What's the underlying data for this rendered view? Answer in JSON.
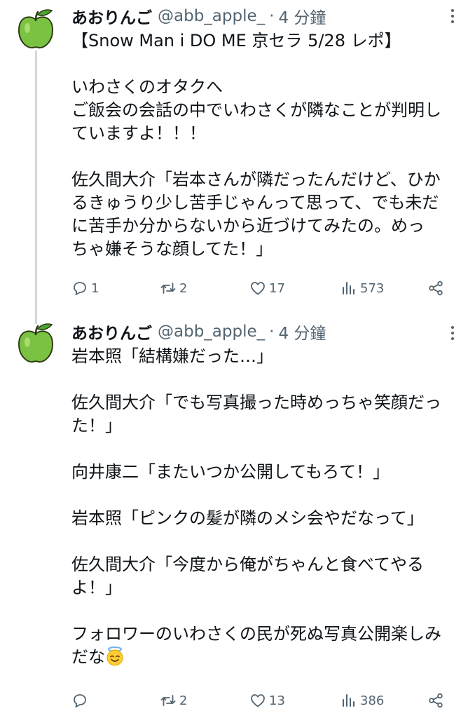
{
  "thread": [
    {
      "avatar_icon": "green-apple-icon",
      "name": "あおりんご",
      "handle": "@abb_apple_",
      "separator": "·",
      "time": "4 分鐘",
      "text": "【Snow Man i DO ME 京セラ 5/28 レポ】\n\nいわさくのオタクへ\nご飯会の会話の中でいわさくが隣なことが判明し\nていますよ！！！\n\n佐久間大介「岩本さんが隣だったんだけど、ひか\nるきゅうり少し苦手じゃんって思って、でも未だ\nに苦手か分からないから近づけてみたの。めっ\nちゃ嫌そうな顔してた！」",
      "actions": {
        "replies": "1",
        "reposts": "2",
        "likes": "17",
        "views": "573"
      }
    },
    {
      "avatar_icon": "green-apple-icon",
      "name": "あおりんご",
      "handle": "@abb_apple_",
      "separator": "·",
      "time": "4 分鐘",
      "text": "岩本照「結構嫌だった…」\n\n佐久間大介「でも写真撮った時めっちゃ笑顔だっ\nた！」\n\n向井康二「またいつか公開してもろて！」\n\n岩本照「ピンクの髪が隣のメシ会やだなって」\n\n佐久間大介「今度から俺がちゃんと食べてやる\nよ！」\n\nフォロワーのいわさくの民が死ぬ写真公開楽しみ\nだな",
      "text_emoji": "smiling-face-with-halo-emoji",
      "actions": {
        "replies": "",
        "reposts": "2",
        "likes": "13",
        "views": "386"
      }
    }
  ],
  "colors": {
    "text": "#0f1419",
    "secondary": "#536471",
    "thread_line": "#cfd9de",
    "apple": "#7cc242"
  }
}
